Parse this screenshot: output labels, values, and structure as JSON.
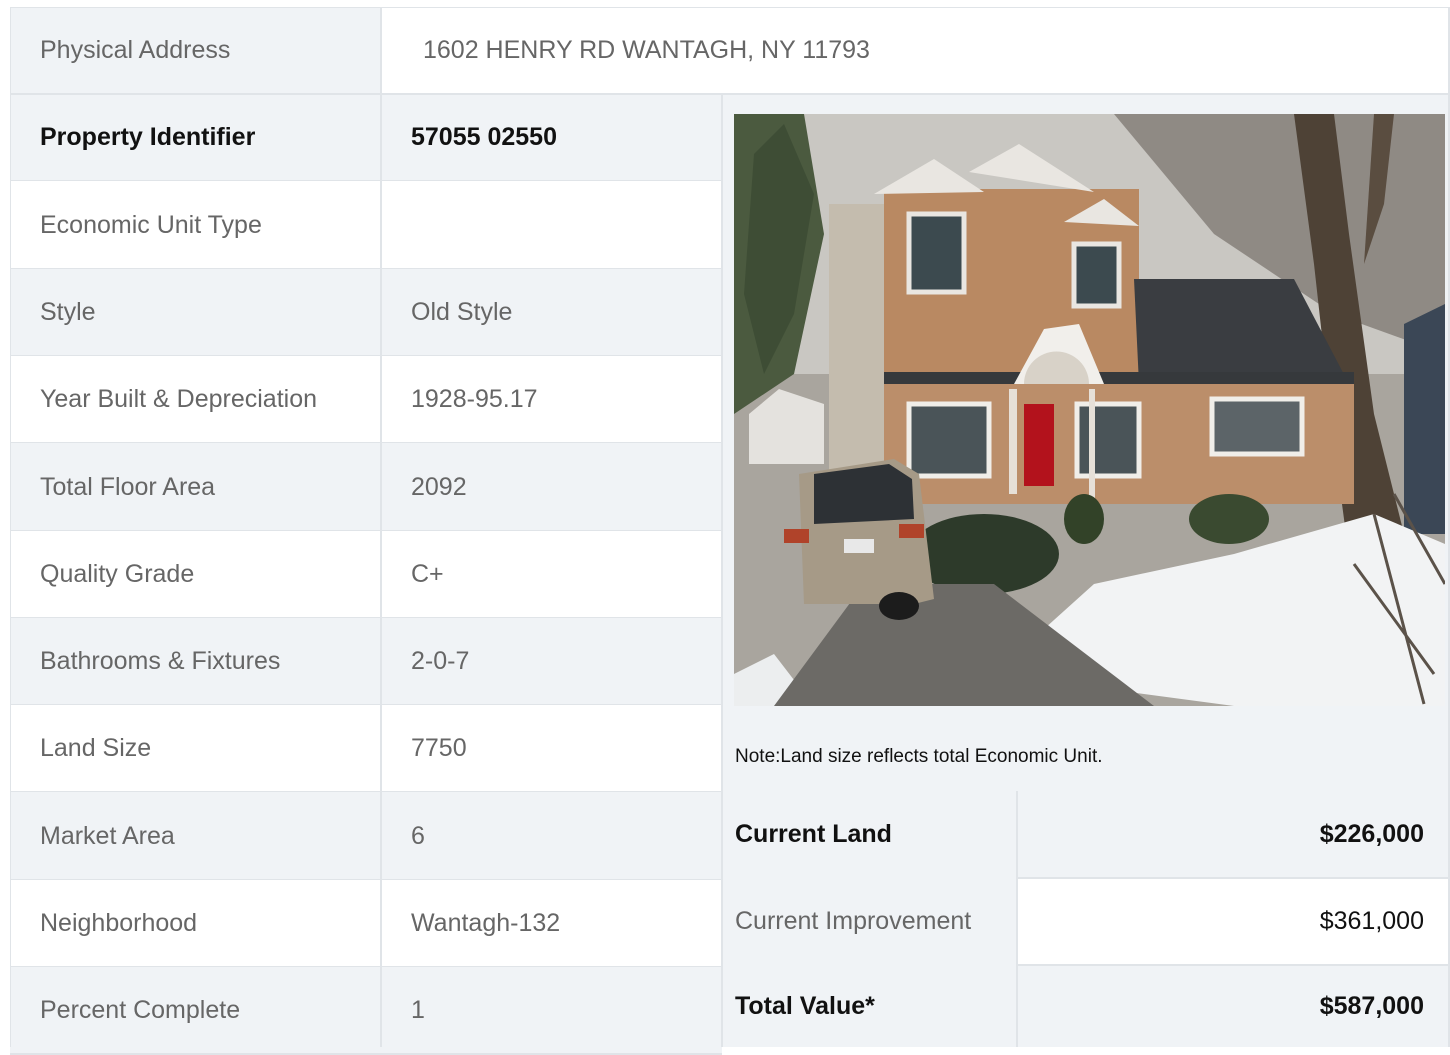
{
  "address": {
    "label": "Physical Address",
    "value": "1602  HENRY RD  WANTAGH, NY  11793"
  },
  "rows": [
    {
      "label": "Property Identifier",
      "value": "57055  02550",
      "bold": true
    },
    {
      "label": "Economic Unit Type",
      "value": ""
    },
    {
      "label": "Style",
      "value": "Old Style"
    },
    {
      "label": "Year Built & Depreciation",
      "value": "1928-95.17"
    },
    {
      "label": "Total Floor Area",
      "value": "2092"
    },
    {
      "label": "Quality Grade",
      "value": "C+"
    },
    {
      "label": "Bathrooms & Fixtures",
      "value": "2-0-7"
    },
    {
      "label": "Land Size",
      "value": "7750"
    },
    {
      "label": "Market Area",
      "value": "6"
    },
    {
      "label": "Neighborhood",
      "value": "Wantagh-132"
    },
    {
      "label": "Percent Complete",
      "value": "1"
    }
  ],
  "note": "Note:Land size reflects total Economic Unit.",
  "values": [
    {
      "label": "Current Land",
      "value": "$226,000",
      "bold": true
    },
    {
      "label": "Current Improvement",
      "value": "$361,000",
      "bold": false
    },
    {
      "label": "Total Value*",
      "value": "$587,000",
      "bold": true
    }
  ],
  "colors": {
    "shade": "#f0f3f6",
    "border": "#e0e4e8",
    "label_text": "#666666",
    "bold_text": "#111111"
  }
}
